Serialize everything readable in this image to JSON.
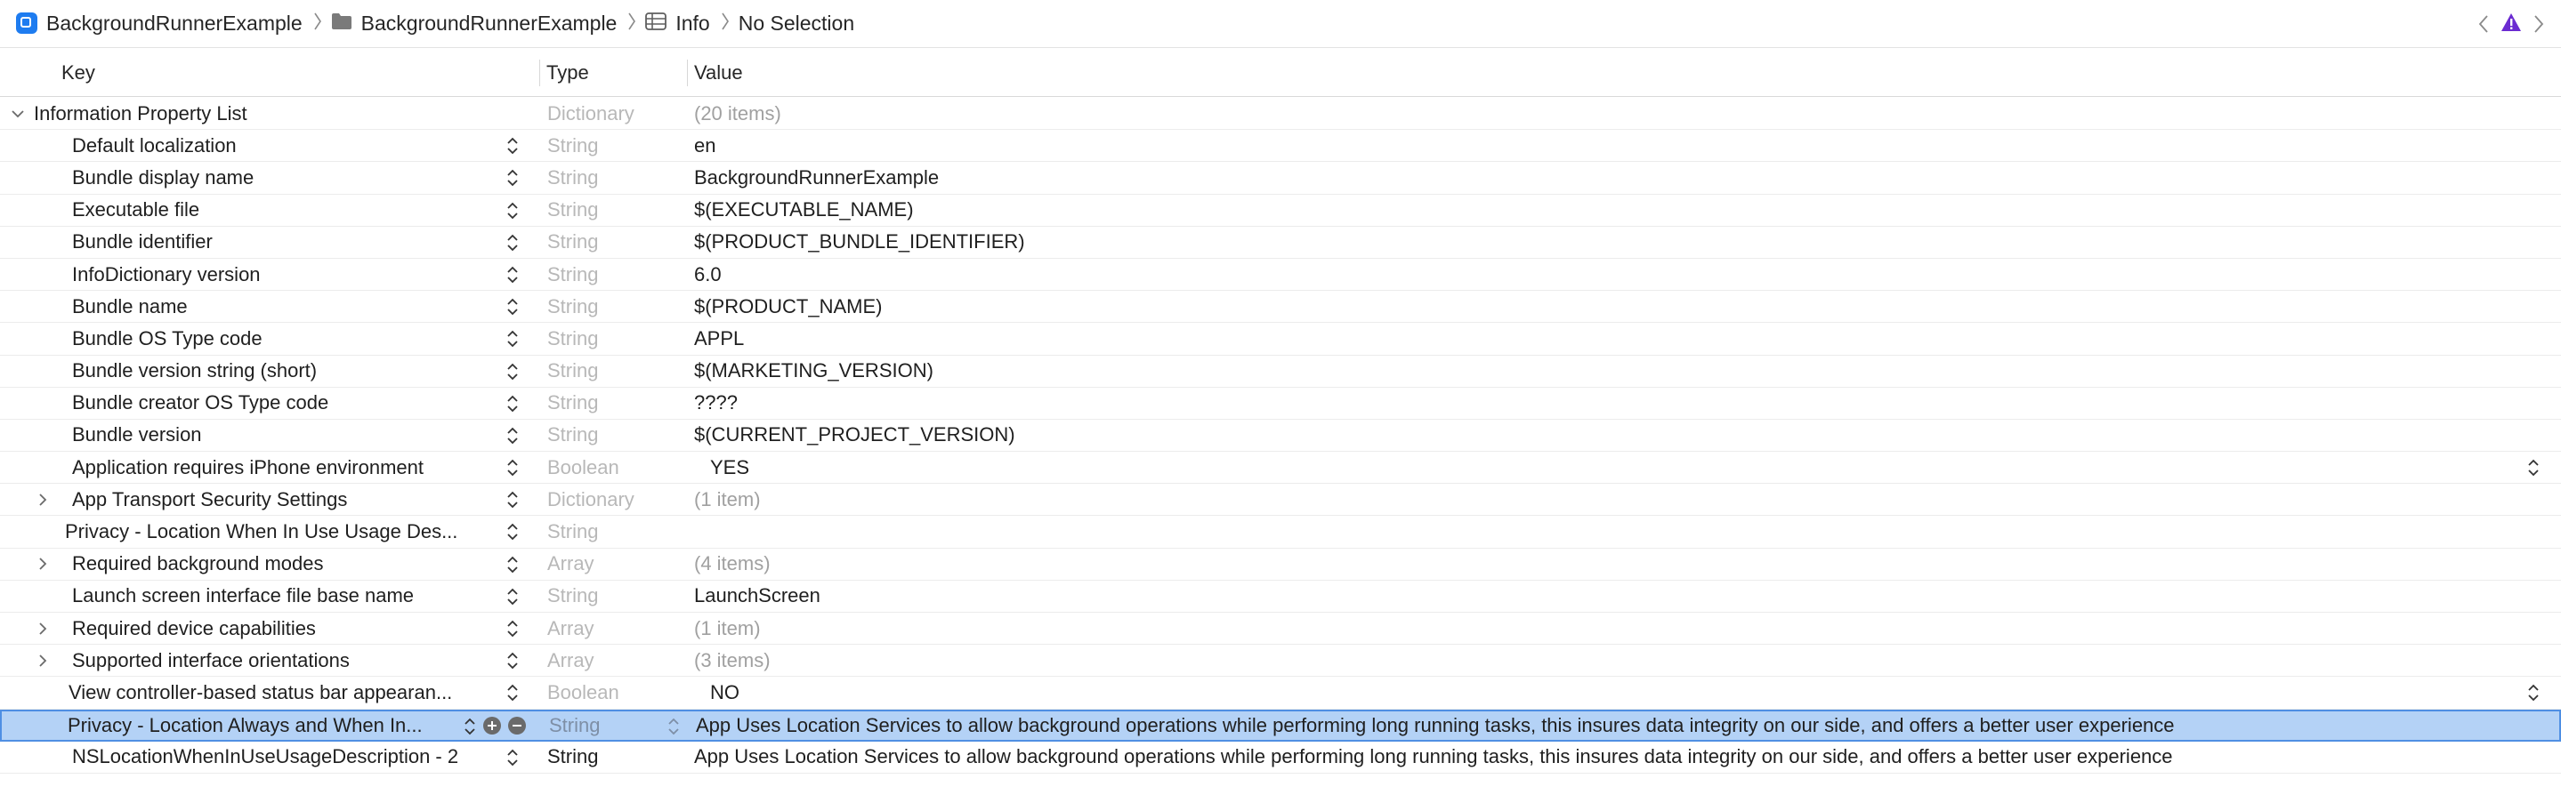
{
  "pathbar": {
    "crumbs": [
      "BackgroundRunnerExample",
      "BackgroundRunnerExample",
      "Info",
      "No Selection"
    ],
    "icons": [
      "app-project-icon",
      "folder-icon",
      "table-icon"
    ]
  },
  "columns": {
    "key": "Key",
    "type": "Type",
    "value": "Value"
  },
  "root": {
    "key": "Information Property List",
    "type": "Dictionary",
    "value": "(20 items)"
  },
  "rows": [
    {
      "key": "Default localization",
      "type": "String",
      "value": "en"
    },
    {
      "key": "Bundle display name",
      "type": "String",
      "value": "BackgroundRunnerExample"
    },
    {
      "key": "Executable file",
      "type": "String",
      "value": "$(EXECUTABLE_NAME)"
    },
    {
      "key": "Bundle identifier",
      "type": "String",
      "value": "$(PRODUCT_BUNDLE_IDENTIFIER)"
    },
    {
      "key": "InfoDictionary version",
      "type": "String",
      "value": "6.0"
    },
    {
      "key": "Bundle name",
      "type": "String",
      "value": "$(PRODUCT_NAME)"
    },
    {
      "key": "Bundle OS Type code",
      "type": "String",
      "value": "APPL"
    },
    {
      "key": "Bundle version string (short)",
      "type": "String",
      "value": "$(MARKETING_VERSION)"
    },
    {
      "key": "Bundle creator OS Type code",
      "type": "String",
      "value": "????"
    },
    {
      "key": "Bundle version",
      "type": "String",
      "value": "$(CURRENT_PROJECT_VERSION)"
    },
    {
      "key": "Application requires iPhone environment",
      "type": "Boolean",
      "value": "YES"
    },
    {
      "key": "App Transport Security Settings",
      "type": "Dictionary",
      "value": "(1 item)"
    },
    {
      "key": "Privacy - Location When In Use Usage Des...",
      "type": "String",
      "value": ""
    },
    {
      "key": "Required background modes",
      "type": "Array",
      "value": "(4 items)"
    },
    {
      "key": "Launch screen interface file base name",
      "type": "String",
      "value": "LaunchScreen"
    },
    {
      "key": "Required device capabilities",
      "type": "Array",
      "value": "(1 item)"
    },
    {
      "key": "Supported interface orientations",
      "type": "Array",
      "value": "(3 items)"
    },
    {
      "key": "View controller-based status bar appearan...",
      "type": "Boolean",
      "value": "NO"
    },
    {
      "key": "Privacy - Location Always and When In...",
      "type": "String",
      "value": "App Uses Location Services to allow background operations while performing long running tasks, this insures data integrity on our side, and offers a better user experience"
    },
    {
      "key": "NSLocationWhenInUseUsageDescription - 2",
      "type": "String",
      "value": "App Uses Location Services to allow background operations while performing long running tasks, this insures data integrity on our side, and offers a better user experience"
    }
  ],
  "colors": {
    "selection": "#b4d2f6",
    "selection_border": "#4f8fe3",
    "warning": "#6b2bd1",
    "project_icon": "#1e7cf0"
  }
}
